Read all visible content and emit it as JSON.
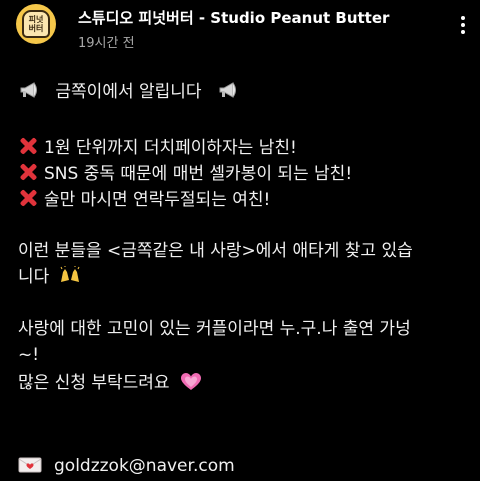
{
  "channel": {
    "avatar_text_top": "피넛",
    "avatar_text_bottom": "버터",
    "name": "스튜디오 피넛버터 - Studio Peanut Butter",
    "time": "19시간 전"
  },
  "post": {
    "heading": "금쪽이에서 알립니다",
    "bullets": [
      "1원 단위까지 더치페이하자는 남친!",
      "SNS 중독 때문에 매번 셀카봉이 되는 남친!",
      "술만 마시면 연락두절되는 여친!"
    ],
    "paragraph1_line1": "이런 분들을 <금쪽같은 내 사랑>에서 애타게 찾고 있습",
    "paragraph1_line2": "니다",
    "paragraph2_line1": "사랑에 대한 고민이 있는 커플이라면 누.구.나 출연 가넝",
    "paragraph2_line2": "~!",
    "paragraph2_line3": "많은 신청 부탁드려요",
    "email": "goldzzok@naver.com"
  },
  "icons": {
    "megaphone": "megaphone-icon",
    "cross": "cross-mark-icon",
    "hands": "raising-hands-icon",
    "heart": "sparkling-heart-icon",
    "envelope": "love-letter-icon",
    "menu": "more-vertical-icon"
  },
  "colors": {
    "background": "#000000",
    "text": "#f1f1f1",
    "meta": "#a8a8a8",
    "cross": "#e0333b",
    "heart": "#f06bb3",
    "avatar": "#f5c74a"
  }
}
